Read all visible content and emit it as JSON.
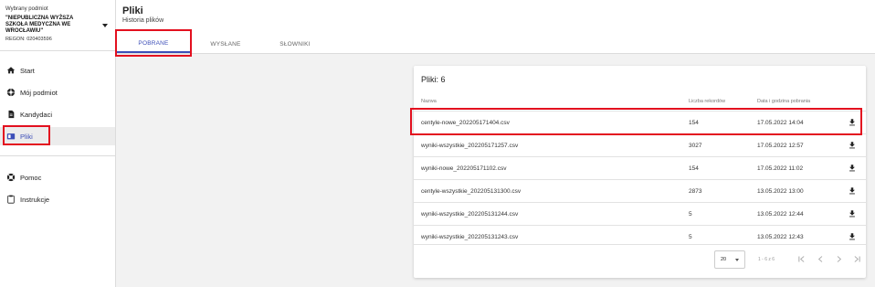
{
  "entity": {
    "label": "Wybrany podmiot",
    "name": "\"NIEPUBLICZNA WYŻSZA SZKOŁA MEDYCZNA WE WROCŁAWIU\"",
    "regon": "REGON: 020403596"
  },
  "nav": {
    "start": "Start",
    "moj_podmiot": "Mój podmiot",
    "kandydaci": "Kandydaci",
    "pliki": "Pliki",
    "pomoc": "Pomoc",
    "instrukcje": "Instrukcje"
  },
  "header": {
    "title": "Pliki",
    "subtitle": "Historia plików",
    "tabs": [
      "POBRANE",
      "WYSŁANE",
      "SŁOWNIKI"
    ]
  },
  "card": {
    "title": "Pliki: 6",
    "columns": [
      "Nazwa",
      "Liczba rekordów",
      "Data i godzina pobrania"
    ],
    "rows": [
      {
        "name": "centyle-nowe_202205171404.csv",
        "count": "154",
        "date": "17.05.2022 14:04"
      },
      {
        "name": "wyniki-wszystkie_202205171257.csv",
        "count": "3027",
        "date": "17.05.2022 12:57"
      },
      {
        "name": "wyniki-nowe_202205171102.csv",
        "count": "154",
        "date": "17.05.2022 11:02"
      },
      {
        "name": "centyle-wszystkie_202205131300.csv",
        "count": "2873",
        "date": "13.05.2022 13:00"
      },
      {
        "name": "wyniki-wszystkie_202205131244.csv",
        "count": "5",
        "date": "13.05.2022 12:44"
      },
      {
        "name": "wyniki-wszystkie_202205131243.csv",
        "count": "5",
        "date": "13.05.2022 12:43"
      }
    ],
    "page_size": "20",
    "range": "1 - 6 z 6"
  },
  "colors": {
    "accent": "#3d4fb8",
    "highlight": "#e3101f"
  }
}
